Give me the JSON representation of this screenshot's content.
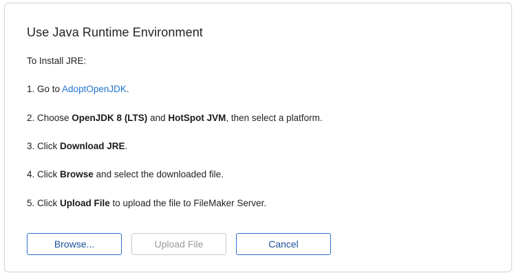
{
  "dialog": {
    "title": "Use Java Runtime Environment",
    "intro": "To Install JRE:",
    "steps": {
      "step1": {
        "prefix": "1. Go to ",
        "link": "AdoptOpenJDK",
        "suffix": "."
      },
      "step2": {
        "prefix": "2. Choose ",
        "bold1": "OpenJDK 8 (LTS)",
        "middle": " and ",
        "bold2": "HotSpot JVM",
        "suffix": ", then select a platform."
      },
      "step3": {
        "prefix": "3. Click ",
        "bold": "Download JRE",
        "suffix": "."
      },
      "step4": {
        "prefix": "4. Click ",
        "bold": "Browse",
        "suffix": " and select the downloaded file."
      },
      "step5": {
        "prefix": "5. Click ",
        "bold": "Upload File",
        "suffix": " to upload the file to FileMaker Server."
      }
    },
    "buttons": {
      "browse": "Browse...",
      "upload": "Upload File",
      "cancel": "Cancel"
    },
    "colors": {
      "link": "#1f74d1",
      "button_border_active": "#2d6fcf",
      "button_text_active": "#1b4f9c",
      "button_text_disabled": "#9a9a9a"
    }
  }
}
